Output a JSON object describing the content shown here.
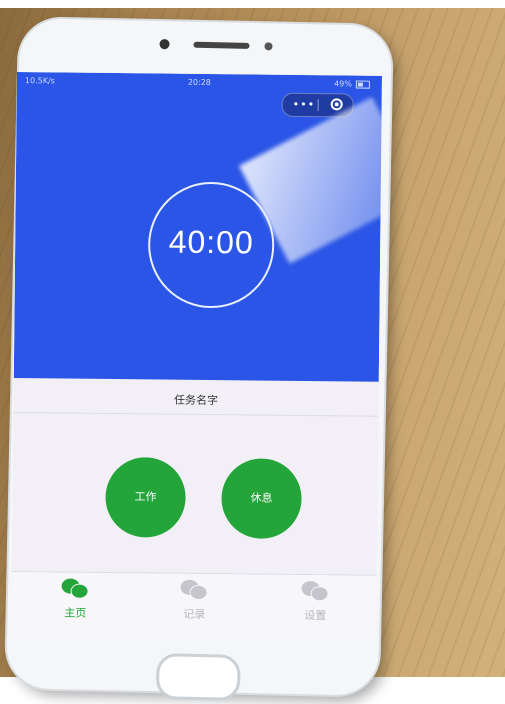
{
  "status_bar": {
    "network": "10.5K/s",
    "time": "20:28",
    "battery": "49%"
  },
  "timer": {
    "value": "40:00"
  },
  "task": {
    "name": "任务名字"
  },
  "buttons": {
    "work": "工作",
    "rest": "休息"
  },
  "tabs": [
    {
      "label": "主页",
      "icon": "chat-icon",
      "active": true
    },
    {
      "label": "记录",
      "icon": "chat-icon",
      "active": false
    },
    {
      "label": "设置",
      "icon": "chat-icon",
      "active": false
    }
  ],
  "colors": {
    "accent_blue": "#2a55e6",
    "accent_green": "#23a53a"
  }
}
